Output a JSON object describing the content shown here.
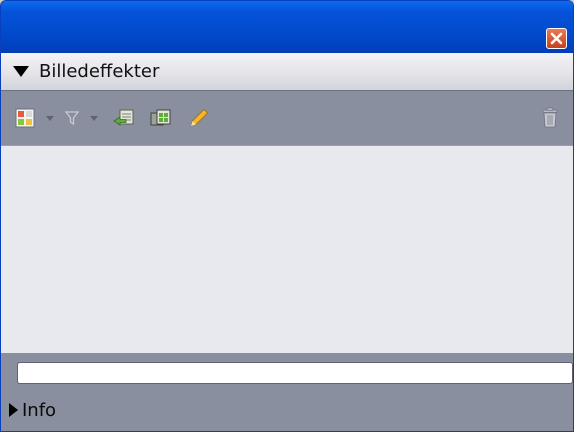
{
  "window": {
    "close_icon": "close-icon"
  },
  "effects_section": {
    "title": "Billedeffekter",
    "expanded": true
  },
  "toolbar": {
    "buttons": [
      {
        "icon": "effect-picker-icon"
      },
      {
        "icon": "dropdown-arrow-icon"
      },
      {
        "icon": "filter-icon"
      },
      {
        "icon": "dropdown-arrow-icon"
      },
      {
        "icon": "move-back-icon"
      },
      {
        "icon": "layers-icon"
      },
      {
        "icon": "pencil-icon"
      },
      {
        "icon": "trash-icon"
      }
    ]
  },
  "effects_list": {
    "items": []
  },
  "name_field": {
    "value": "",
    "placeholder": ""
  },
  "info_section": {
    "label": "Info",
    "expanded": false
  },
  "colors": {
    "title_bar": "#0148c8",
    "panel_bg": "#8a8fa0",
    "list_bg": "#e8e9ee",
    "close_red": "#c7401c"
  }
}
